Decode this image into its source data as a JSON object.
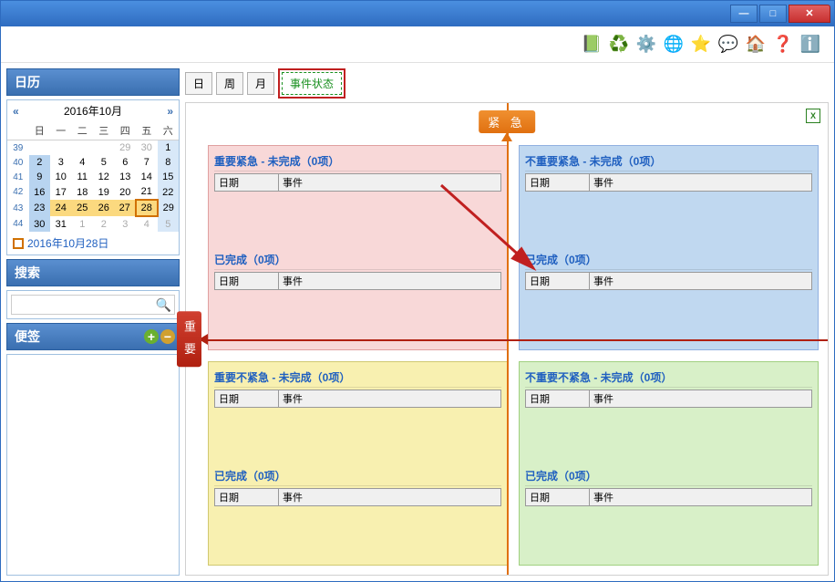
{
  "sidebar": {
    "calendar_label": "日历",
    "search_label": "搜索",
    "notes_label": "便签"
  },
  "calendar": {
    "month_title": "2016年10月",
    "prev": "«",
    "next": "»",
    "weekdays": [
      "日",
      "一",
      "二",
      "三",
      "四",
      "五",
      "六"
    ],
    "rows": [
      {
        "wk": "39",
        "days": [
          {
            "n": "",
            "cls": ""
          },
          {
            "n": "",
            "cls": ""
          },
          {
            "n": "",
            "cls": ""
          },
          {
            "n": "",
            "cls": ""
          },
          {
            "n": "29",
            "cls": "othermonth"
          },
          {
            "n": "30",
            "cls": "othermonth"
          },
          {
            "n": "1",
            "cls": "weekend-bg"
          }
        ]
      },
      {
        "wk": "40",
        "days": [
          {
            "n": "2",
            "cls": "sel"
          },
          {
            "n": "3",
            "cls": ""
          },
          {
            "n": "4",
            "cls": ""
          },
          {
            "n": "5",
            "cls": ""
          },
          {
            "n": "6",
            "cls": ""
          },
          {
            "n": "7",
            "cls": ""
          },
          {
            "n": "8",
            "cls": "weekend-bg"
          }
        ]
      },
      {
        "wk": "41",
        "days": [
          {
            "n": "9",
            "cls": "sel"
          },
          {
            "n": "10",
            "cls": ""
          },
          {
            "n": "11",
            "cls": ""
          },
          {
            "n": "12",
            "cls": ""
          },
          {
            "n": "13",
            "cls": ""
          },
          {
            "n": "14",
            "cls": ""
          },
          {
            "n": "15",
            "cls": "weekend-bg"
          }
        ]
      },
      {
        "wk": "42",
        "days": [
          {
            "n": "16",
            "cls": "sel"
          },
          {
            "n": "17",
            "cls": ""
          },
          {
            "n": "18",
            "cls": ""
          },
          {
            "n": "19",
            "cls": ""
          },
          {
            "n": "20",
            "cls": ""
          },
          {
            "n": "21",
            "cls": ""
          },
          {
            "n": "22",
            "cls": "weekend-bg"
          }
        ]
      },
      {
        "wk": "43",
        "days": [
          {
            "n": "23",
            "cls": "sel"
          },
          {
            "n": "24",
            "cls": "hl-week"
          },
          {
            "n": "25",
            "cls": "hl-week"
          },
          {
            "n": "26",
            "cls": "hl-week"
          },
          {
            "n": "27",
            "cls": "hl-week"
          },
          {
            "n": "28",
            "cls": "today"
          },
          {
            "n": "29",
            "cls": "weekend-bg"
          }
        ]
      },
      {
        "wk": "44",
        "days": [
          {
            "n": "30",
            "cls": "sel"
          },
          {
            "n": "31",
            "cls": ""
          },
          {
            "n": "1",
            "cls": "othermonth"
          },
          {
            "n": "2",
            "cls": "othermonth"
          },
          {
            "n": "3",
            "cls": "othermonth"
          },
          {
            "n": "4",
            "cls": "othermonth"
          },
          {
            "n": "5",
            "cls": "othermonth weekend-bg"
          }
        ]
      }
    ],
    "today_label": "2016年10月28日"
  },
  "tabs": {
    "day": "日",
    "week": "周",
    "month": "月",
    "status": "事件状态"
  },
  "axes": {
    "urgent": "紧 急",
    "important": "重 要"
  },
  "quads": {
    "q1": {
      "incomplete": "重要紧急 - 未完成（0项）",
      "complete": "已完成（0项）"
    },
    "q2": {
      "incomplete": "不重要紧急 - 未完成（0项）",
      "complete": "已完成（0项）"
    },
    "q3": {
      "incomplete": "重要不紧急 - 未完成（0项）",
      "complete": "已完成（0项）"
    },
    "q4": {
      "incomplete": "不重要不紧急 - 未完成（0项）",
      "complete": "已完成（0项）"
    }
  },
  "columns": {
    "date": "日期",
    "event": "事件"
  },
  "search": {
    "placeholder": ""
  },
  "excel": "X"
}
